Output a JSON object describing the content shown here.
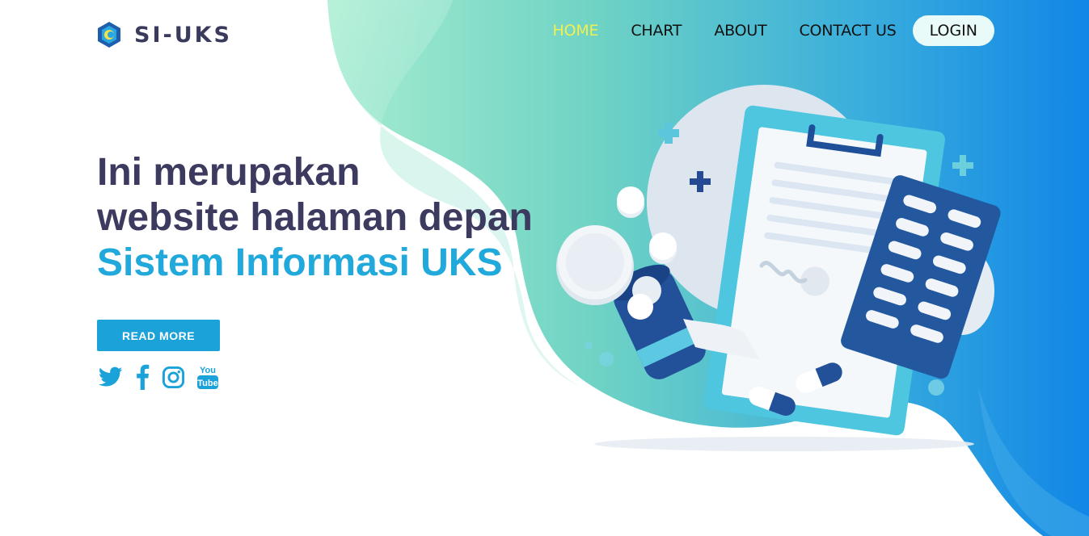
{
  "brand": {
    "name": "SI-UKS"
  },
  "nav": {
    "items": [
      {
        "label": "HOME",
        "active": true
      },
      {
        "label": "CHART",
        "active": false
      },
      {
        "label": "ABOUT",
        "active": false
      },
      {
        "label": "CONTACT US",
        "active": false
      }
    ],
    "login_label": "LOGIN"
  },
  "hero": {
    "line1": "Ini merupakan",
    "line2": "website halaman depan",
    "line3": "Sistem Informasi UKS",
    "button_label": "READ MORE"
  },
  "social": {
    "icons": [
      "twitter-icon",
      "facebook-icon",
      "instagram-icon",
      "youtube-icon"
    ],
    "youtube_top": "You",
    "youtube_bottom": "Tube"
  },
  "colors": {
    "accent": "#1ba3d9",
    "heading": "#3c3a5e",
    "nav_active": "#f0f050",
    "gradient_start": "#9ae8c8",
    "gradient_end": "#1a8fe6"
  }
}
